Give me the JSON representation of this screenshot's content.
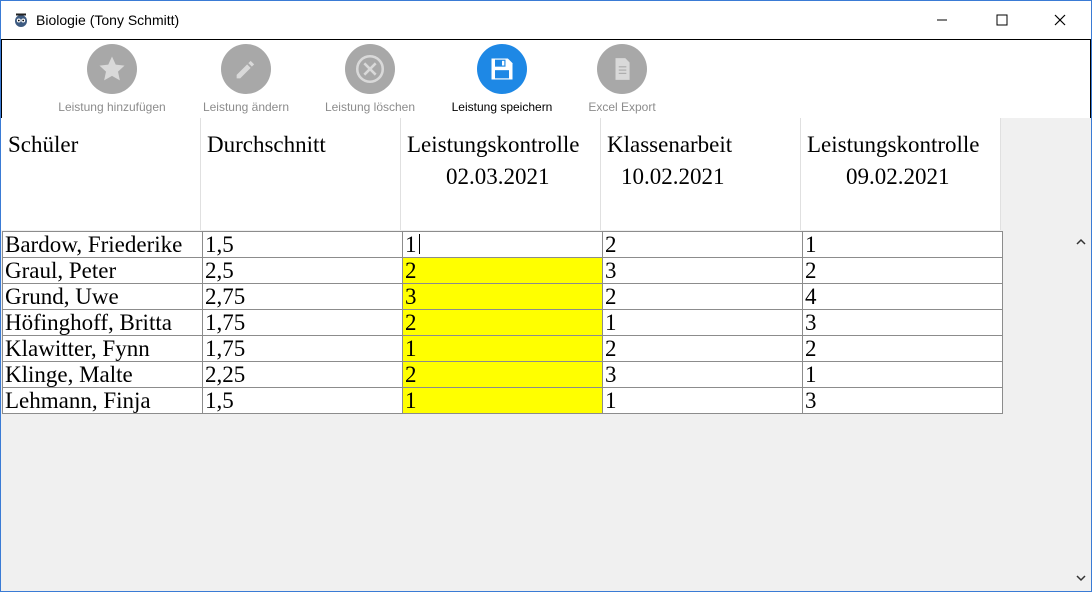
{
  "window": {
    "title": "Biologie (Tony Schmitt)"
  },
  "toolbar": {
    "add_label": "Leistung hinzufügen",
    "edit_label": "Leistung ändern",
    "delete_label": "Leistung löschen",
    "save_label": "Leistung speichern",
    "export_label": "Excel Export"
  },
  "grid": {
    "headers": {
      "student": "Schüler",
      "average": "Durchschnitt",
      "col1_title": "Leistungskontrolle",
      "col1_date": "02.03.2021",
      "col2_title": "Klassenarbeit",
      "col2_date": "10.02.2021",
      "col3_title": "Leistungskontrolle",
      "col3_date": "09.02.2021"
    },
    "rows": [
      {
        "name": "Bardow, Friederike",
        "avg": "1,5",
        "c1": "1",
        "c2": "2",
        "c3": "1"
      },
      {
        "name": "Graul, Peter",
        "avg": "2,5",
        "c1": "2",
        "c2": "3",
        "c3": "2"
      },
      {
        "name": "Grund, Uwe",
        "avg": "2,75",
        "c1": "3",
        "c2": "2",
        "c3": "4"
      },
      {
        "name": "Höfinghoff, Britta",
        "avg": "1,75",
        "c1": "2",
        "c2": "1",
        "c3": "3"
      },
      {
        "name": "Klawitter, Fynn",
        "avg": "1,75",
        "c1": "1",
        "c2": "2",
        "c3": "2"
      },
      {
        "name": "Klinge, Malte",
        "avg": "2,25",
        "c1": "2",
        "c2": "3",
        "c3": "1"
      },
      {
        "name": "Lehmann, Finja",
        "avg": "1,5",
        "c1": "1",
        "c2": "1",
        "c3": "3"
      }
    ]
  },
  "colors": {
    "highlight": "#ffff00",
    "save_accent": "#1e88e5",
    "disabled_icon": "#a8a8a8"
  },
  "icons": {
    "add": "star-icon",
    "edit": "pencil-icon",
    "delete": "circle-x-icon",
    "save": "floppy-disk-icon",
    "export": "document-icon"
  }
}
